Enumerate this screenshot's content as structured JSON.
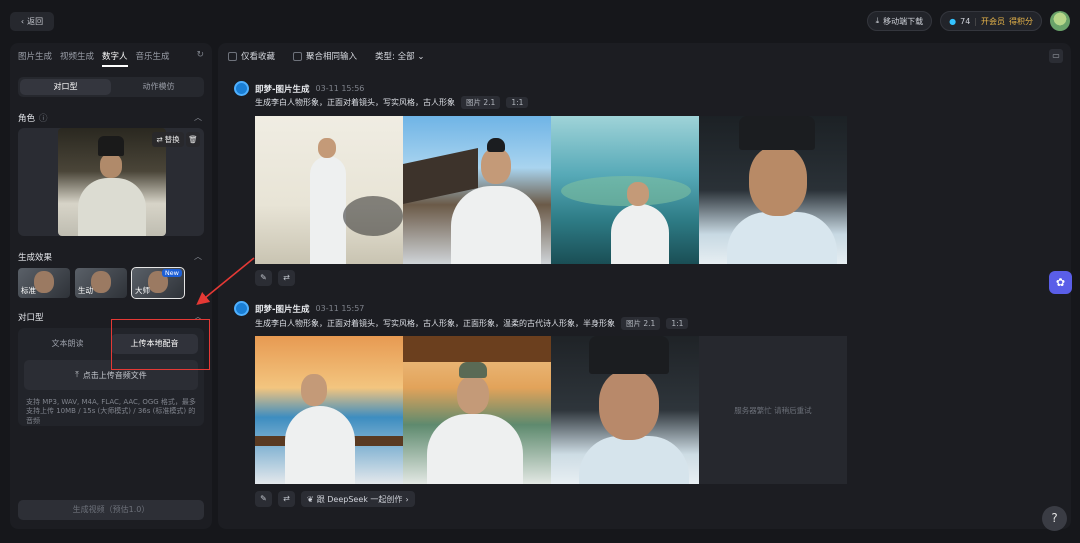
{
  "topbar": {
    "back_label": "返回",
    "download_label": "移动端下载",
    "points": "74",
    "vip_label": "开会员",
    "earn_label": "得积分"
  },
  "left": {
    "tabs": [
      "图片生成",
      "视频生成",
      "数字人",
      "音乐生成"
    ],
    "active_tab": 2,
    "mode_options": [
      "对口型",
      "动作模仿"
    ],
    "role_title": "角色",
    "role_replace": "替换",
    "effect_title": "生成效果",
    "effects": [
      {
        "label": "标准"
      },
      {
        "label": "生动"
      },
      {
        "label": "大师",
        "badge": "New"
      }
    ],
    "lipsync_title": "对口型",
    "dub_options": [
      "文本朗读",
      "上传本地配音"
    ],
    "upload_label": "点击上传音频文件",
    "upload_note": "支持 MP3, WAV, M4A, FLAC, AAC, OGG 格式，最多支持上传 10MB / 15s (大师模式) / 36s (标准模式) 的音频",
    "generate_label": "生成视频（预估1.0）"
  },
  "right": {
    "filter_favorite": "仅看收藏",
    "filter_merge": "聚合相同输入",
    "filter_type": "类型: 全部",
    "posts": [
      {
        "title": "即梦-图片生成",
        "time": "03-11 15:56",
        "prompt": "生成李白人物形象，正面对着镜头，写实风格，古人形象",
        "tags": [
          "图片 2.1",
          "1:1"
        ]
      },
      {
        "title": "即梦-图片生成",
        "time": "03-11 15:57",
        "prompt": "生成李白人物形象，正面对着镜头，写实风格，古人形象，正面形象，温柔的古代诗人形象，半身形象",
        "tags": [
          "图片 2.1",
          "1:1"
        ],
        "placeholder": "服务器繁忙 请稍后重试",
        "deepseek_label": "跟 DeepSeek 一起创作"
      }
    ]
  },
  "colors": {
    "accent": "#33c3ff",
    "annotation": "#e53935",
    "float_button": "#5a5ee8"
  },
  "icons": [
    "chevron-left-icon",
    "download-icon",
    "coin-icon",
    "refresh-icon",
    "info-icon",
    "swap-icon",
    "trash-icon",
    "chevron-up-icon",
    "upload-icon",
    "folder-icon",
    "edit-icon",
    "regenerate-icon",
    "deepseek-icon",
    "chevron-right-icon",
    "sparkle-icon",
    "help-icon"
  ]
}
